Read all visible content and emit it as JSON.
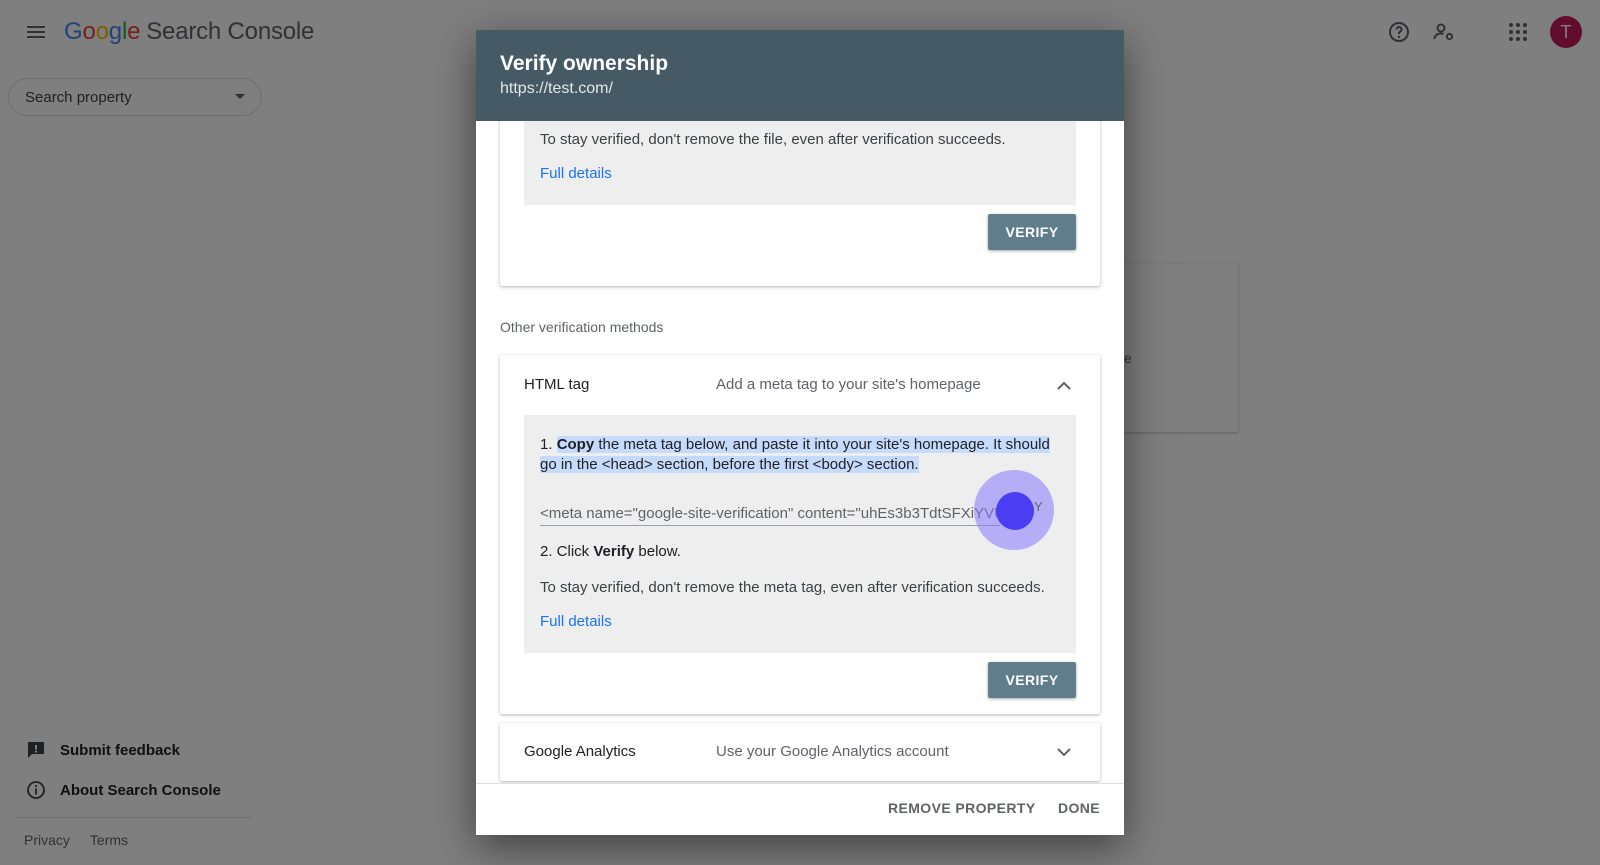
{
  "app": {
    "logo_letters": [
      "G",
      "o",
      "o",
      "g",
      "l",
      "e"
    ],
    "product": "Search Console",
    "avatar_initial": "T"
  },
  "colors": {
    "header_bg": "#455a64",
    "verify_button": "#607d8b",
    "link": "#1a73e8",
    "avatar": "#c2185b",
    "highlight": "#c6dafc"
  },
  "icons": {
    "menu": "hamburger-menu-icon",
    "help": "help-circle-icon",
    "admin": "person-gear-icon",
    "apps": "apps-grid-icon",
    "feedback": "feedback-icon",
    "info": "info-circle-icon",
    "expand": "chevron-down-icon",
    "collapse": "chevron-up-icon"
  },
  "sidebar": {
    "search_placeholder": "Search property",
    "submit_feedback": "Submit feedback",
    "about": "About Search Console",
    "privacy": "Privacy",
    "terms": "Terms"
  },
  "background": {
    "card_fragment": "e"
  },
  "dialog": {
    "title": "Verify ownership",
    "subtitle": "https://test.com/",
    "top_card": {
      "stay_verified": "To stay verified, don't remove the file, even after verification succeeds.",
      "full_details": "Full details",
      "verify_label": "VERIFY"
    },
    "other_methods_label": "Other verification methods",
    "html_tag": {
      "title": "HTML tag",
      "description": "Add a meta tag to your site's homepage",
      "step1_number": "1.",
      "step1_bold": "Copy",
      "step1_rest": "the meta tag below, and paste it into your site's homepage. It should go in the <head> section, before the first <body> section.",
      "meta_value": "<meta name=\"google-site-verification\" content=\"uhEs3b3TdtSFXiYVU",
      "copy_fragment": "Y",
      "step2_prefix": "2. Click",
      "step2_bold": "Verify",
      "step2_suffix": "below.",
      "stay_verified": "To stay verified, don't remove the meta tag, even after verification succeeds.",
      "full_details": "Full details",
      "verify_label": "VERIFY"
    },
    "google_analytics": {
      "title": "Google Analytics",
      "description": "Use your Google Analytics account"
    },
    "footer": {
      "remove_property": "REMOVE PROPERTY",
      "done": "DONE"
    }
  }
}
